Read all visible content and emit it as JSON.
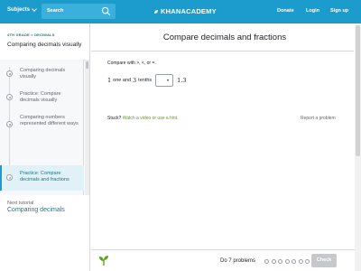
{
  "topbar": {
    "subjects_label": "Subjects",
    "search_placeholder": "Search",
    "logo_text": "KHANACADEMY",
    "donate": "Donate",
    "login": "Login",
    "signup": "Sign up"
  },
  "sidebar": {
    "breadcrumb": "4TH GRADE > DECIMALS",
    "title": "Comparing decimals visually",
    "items": [
      {
        "label": "Comparing decimals visually"
      },
      {
        "label": "Practice: Compare decimals visually"
      },
      {
        "label": "Comparing numbers represented different ways"
      },
      {
        "label": "Practice: Compare decimals and fractions"
      }
    ],
    "next_tutorial_label": "Next tutorial",
    "next_tutorial_link": "Comparing decimals"
  },
  "main": {
    "title": "Compare decimals and fractions",
    "instruction": "Compare with >, <, or =.",
    "problem": {
      "left_num1": "1",
      "left_word1": "one and",
      "left_num2": "3",
      "left_word2": "tenths",
      "right_value": "1.3"
    },
    "stuck_label": "Stuck?",
    "stuck_link": "Watch a video or use a hint.",
    "report": "Report a problem"
  },
  "footer": {
    "do_text": "Do 7 problems",
    "check_label": "Check",
    "progress_total": 7,
    "progress_done": 0
  },
  "colors": {
    "brand_blue": "#1c9ccd",
    "link_green": "#5aa21b",
    "teal_link": "#1c758a"
  }
}
